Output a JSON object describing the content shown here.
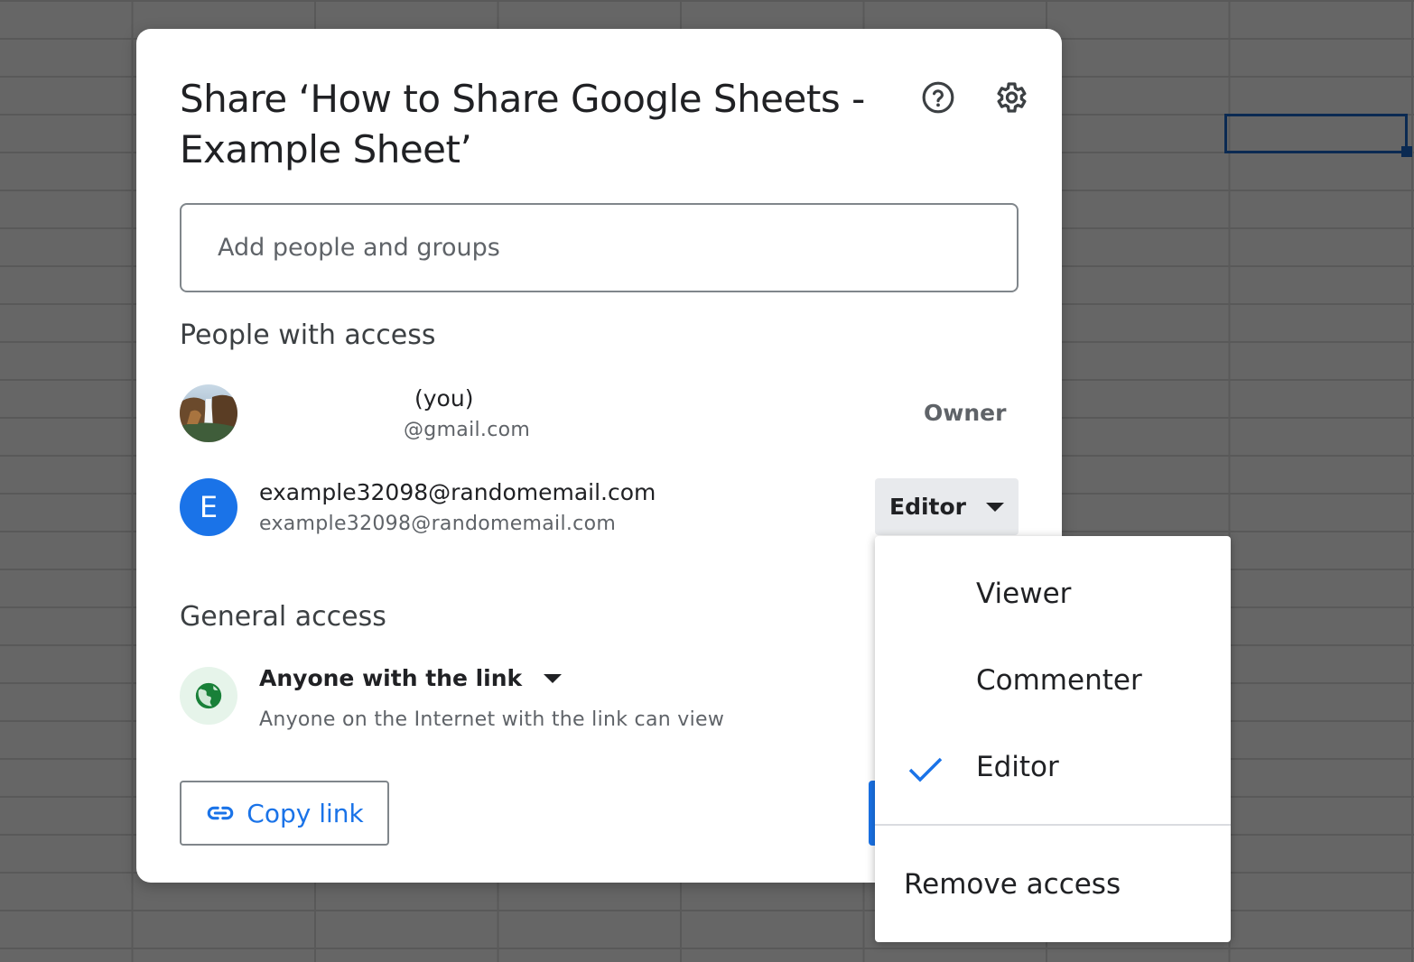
{
  "dialog": {
    "title": "Share ‘How to Share Google Sheets - Example Sheet’",
    "help_icon": "help-circle-icon",
    "settings_icon": "gear-icon"
  },
  "add_people": {
    "placeholder": "Add people and groups",
    "value": ""
  },
  "people_section": {
    "heading": "People with access",
    "people": [
      {
        "name": "(you)",
        "email": "@gmail.com",
        "role": "Owner"
      },
      {
        "initial": "E",
        "name": "example32098@randomemail.com",
        "email": "example32098@randomemail.com",
        "role": "Editor"
      }
    ]
  },
  "general_access": {
    "heading": "General access",
    "option": "Anyone with the link",
    "description": "Anyone on the Internet with the link can view"
  },
  "copy_link": {
    "label": "Copy link"
  },
  "role_menu": {
    "items": [
      "Viewer",
      "Commenter",
      "Editor"
    ],
    "selected": "Editor",
    "remove": "Remove access"
  },
  "colors": {
    "accent": "#1a73e8",
    "globe": "#188038",
    "backdrop": "#666666"
  }
}
